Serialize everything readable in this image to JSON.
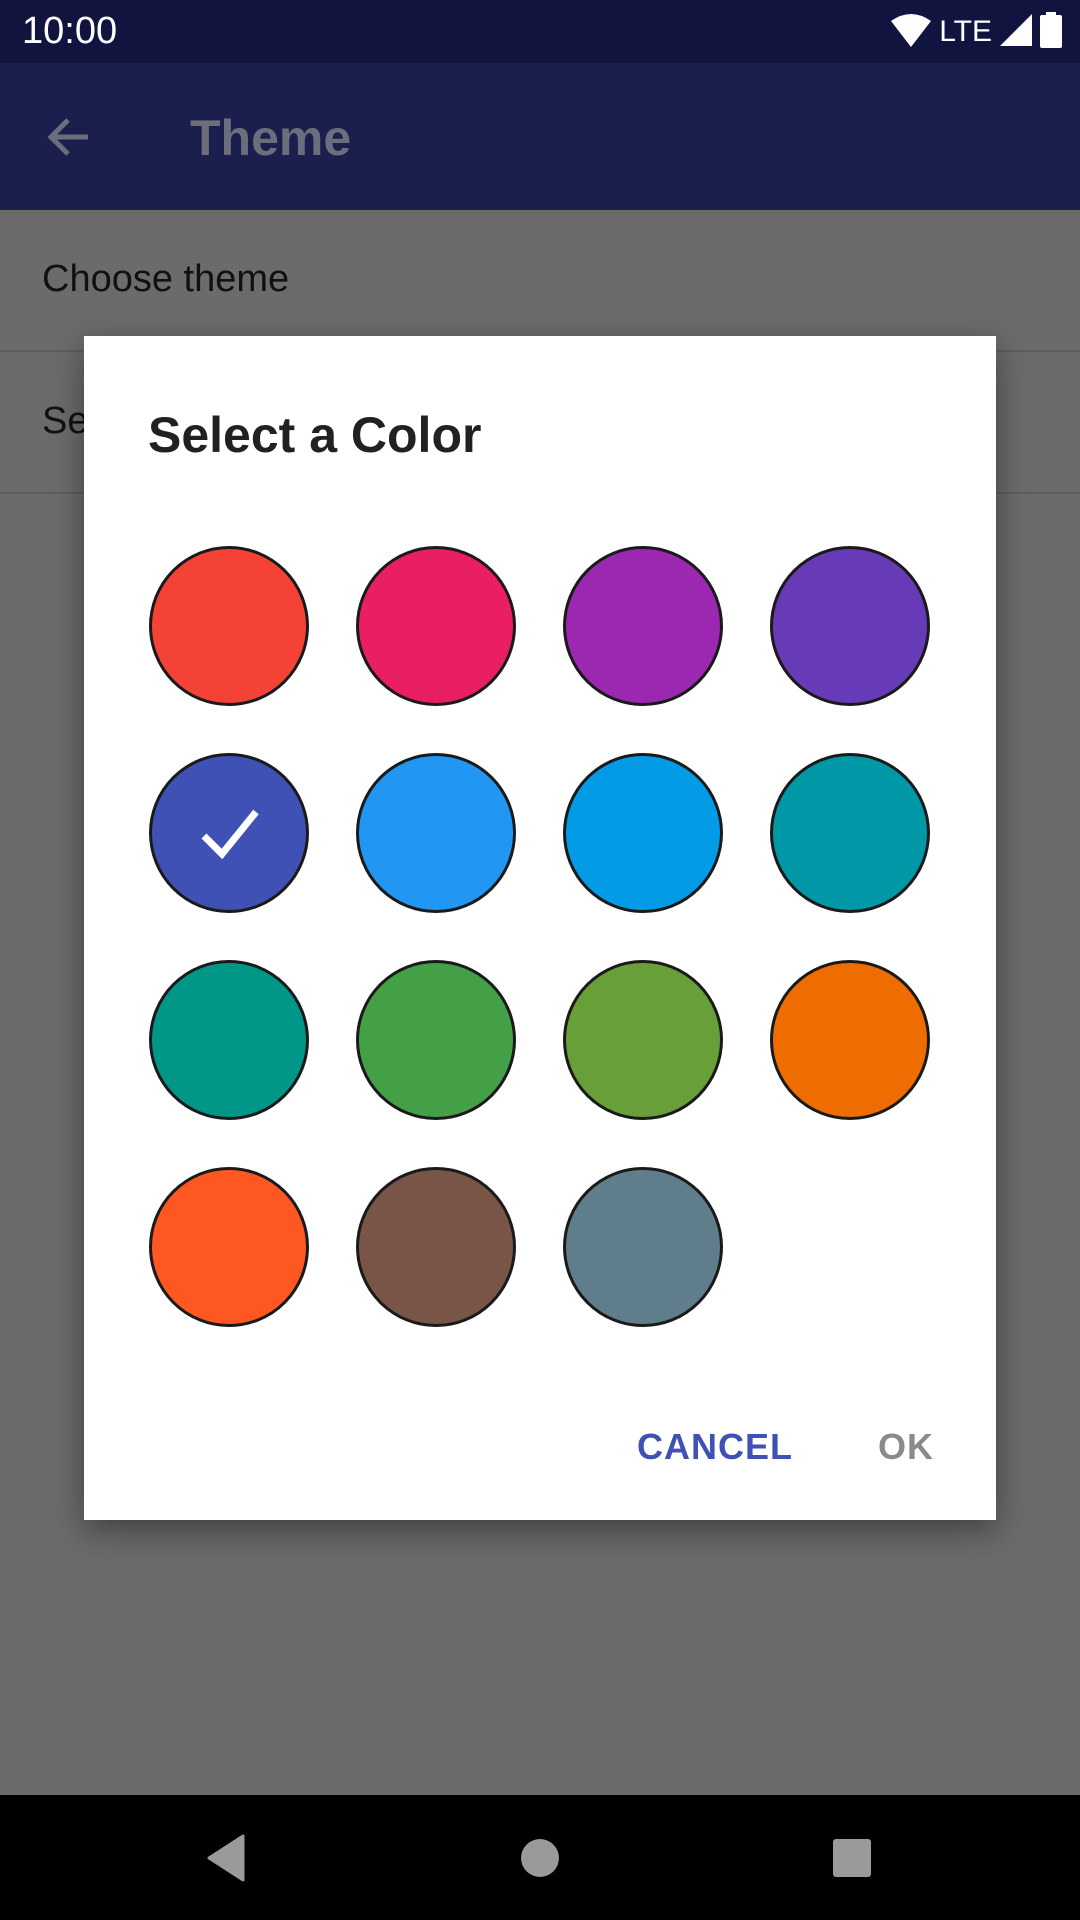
{
  "status_bar": {
    "time": "10:00",
    "network_label": "LTE",
    "icons": [
      "wifi-icon",
      "lte-icon",
      "signal-icon",
      "battery-icon"
    ]
  },
  "app_bar": {
    "back_icon": "arrow-left-icon",
    "title": "Theme"
  },
  "preferences": [
    {
      "label": "Choose theme"
    },
    {
      "label": "Se"
    }
  ],
  "dialog": {
    "title": "Select a Color",
    "selected_index": 4,
    "colors": [
      {
        "name": "red",
        "hex": "#f44336"
      },
      {
        "name": "pink",
        "hex": "#e91e63"
      },
      {
        "name": "purple",
        "hex": "#9c27b0"
      },
      {
        "name": "deep-purple",
        "hex": "#673ab7"
      },
      {
        "name": "indigo",
        "hex": "#3f51b5"
      },
      {
        "name": "blue",
        "hex": "#2196f3"
      },
      {
        "name": "light-blue",
        "hex": "#039be5"
      },
      {
        "name": "cyan",
        "hex": "#0097a7"
      },
      {
        "name": "teal",
        "hex": "#009688"
      },
      {
        "name": "green",
        "hex": "#43a047"
      },
      {
        "name": "light-green",
        "hex": "#689f38"
      },
      {
        "name": "orange",
        "hex": "#ef6c00"
      },
      {
        "name": "deep-orange",
        "hex": "#ff5722"
      },
      {
        "name": "brown",
        "hex": "#795548"
      },
      {
        "name": "blue-grey",
        "hex": "#607d8b"
      }
    ],
    "cancel_label": "CANCEL",
    "ok_label": "OK"
  },
  "nav_bar": {
    "back_icon": "nav-back-icon",
    "home_icon": "nav-home-icon",
    "recents_icon": "nav-recents-icon"
  },
  "colors": {
    "status_bar_bg": "#10143f",
    "app_bar_bg": "#1a1f4d",
    "accent": "#3f51b5",
    "scrim": "#6b6b6b"
  }
}
